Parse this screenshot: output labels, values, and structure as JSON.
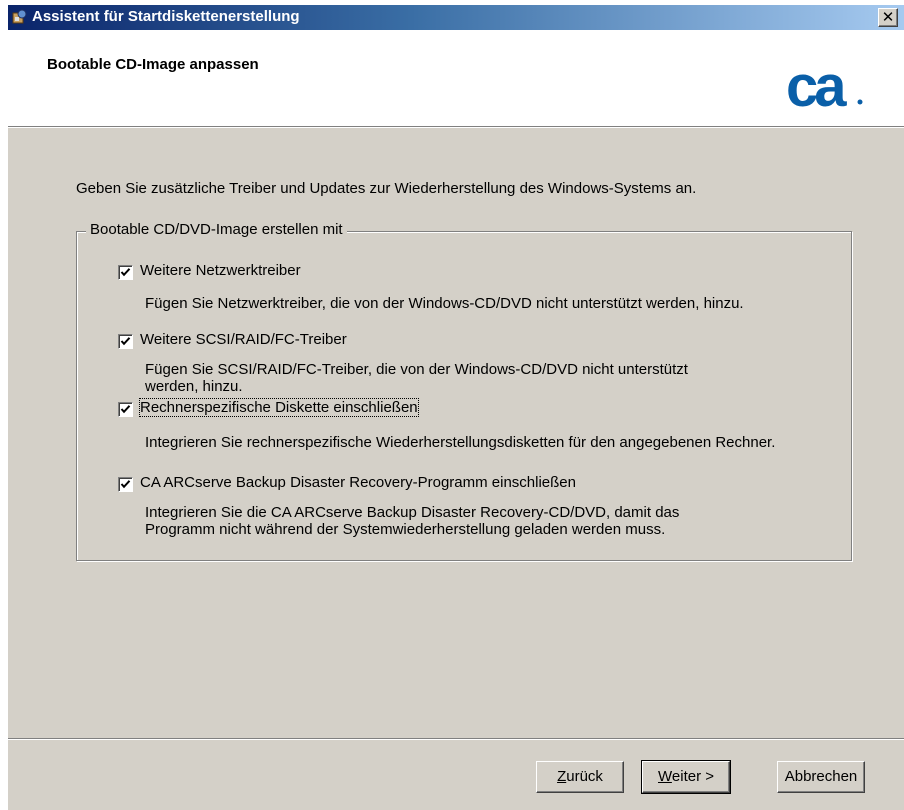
{
  "window": {
    "title": "Assistent für Startdiskettenerstellung",
    "close_glyph": "✕"
  },
  "header": {
    "title": "Bootable CD-Image anpassen",
    "logo_text": "ca"
  },
  "intro": "Geben Sie zusätzliche Treiber und Updates zur Wiederherstellung des Windows-Systems an.",
  "group": {
    "legend": "Bootable CD/DVD-Image erstellen mit",
    "options": [
      {
        "label": "Weitere Netzwerktreiber",
        "checked": true,
        "desc": [
          "Fügen Sie Netzwerktreiber, die von der Windows-CD/DVD nicht unterstützt werden, hinzu."
        ]
      },
      {
        "label": "Weitere SCSI/RAID/FC-Treiber",
        "checked": true,
        "desc": [
          "Fügen Sie SCSI/RAID/FC-Treiber, die von der Windows-CD/DVD nicht unterstützt",
          "werden, hinzu."
        ]
      },
      {
        "label": "Rechnerspezifische Diskette einschließen",
        "checked": true,
        "desc": [
          "Integrieren Sie rechnerspezifische Wiederherstellungsdisketten für den angegebenen Rechner."
        ]
      },
      {
        "label": "CA ARCserve Backup Disaster Recovery-Programm einschließen",
        "checked": true,
        "desc": [
          "Integrieren Sie die CA ARCserve Backup Disaster Recovery-CD/DVD, damit das",
          "Programm nicht während der Systemwiederherstellung geladen werden muss."
        ]
      }
    ]
  },
  "buttons": {
    "back": {
      "mnemonic": "Z",
      "rest": "urück"
    },
    "next": {
      "mnemonic": "W",
      "rest": "eiter >"
    },
    "cancel": "Abbrechen"
  },
  "colors": {
    "title_bar_start": "#0a246a",
    "title_bar_end": "#a6caf0",
    "face": "#d4d0c8",
    "logo": "#0a5fa8"
  }
}
